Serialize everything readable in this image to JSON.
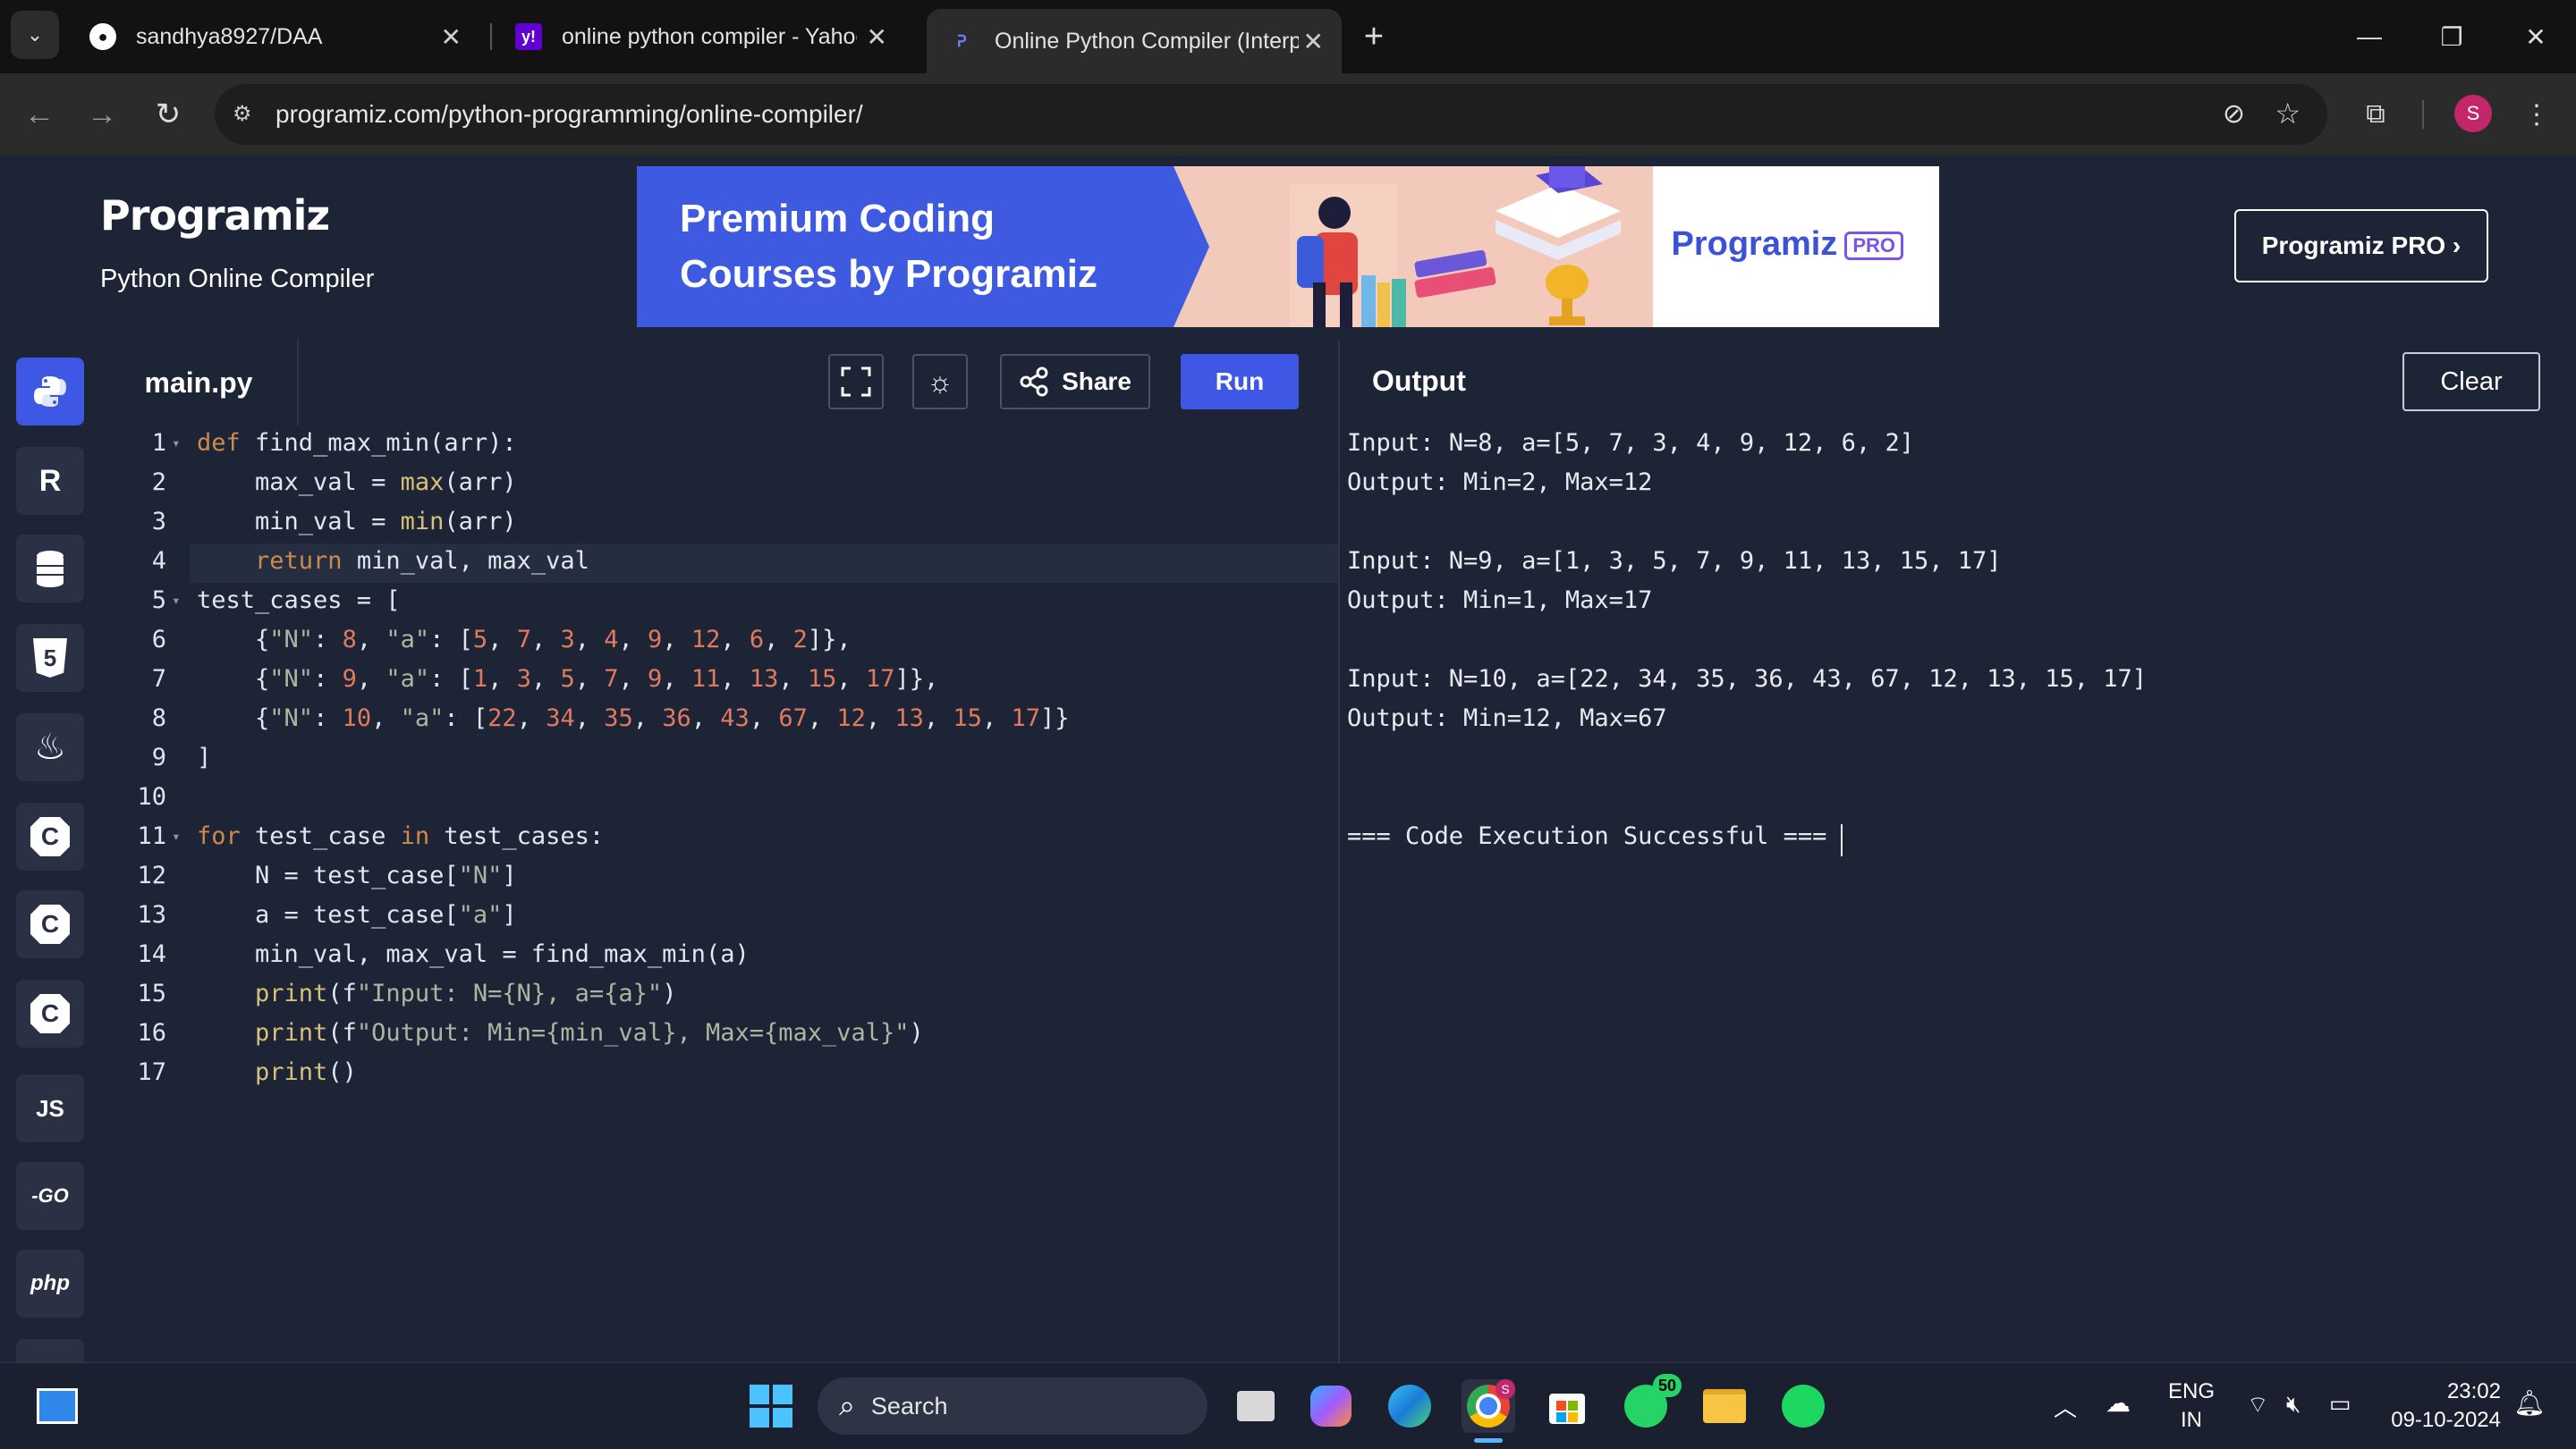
{
  "browser": {
    "tabs": [
      {
        "title": "sandhya8927/DAA",
        "icon": "github-icon"
      },
      {
        "title": "online python compiler - Yahoo",
        "icon": "yahoo-icon"
      },
      {
        "title": "Online Python Compiler (Interp",
        "icon": "programiz-icon",
        "active": true
      }
    ],
    "new_tab": "+",
    "url": "programiz.com/python-programming/online-compiler/",
    "profile_initial": "S"
  },
  "header": {
    "logo": "Programiz",
    "subtitle": "Python Online Compiler",
    "banner_headline_1": "Premium Coding",
    "banner_headline_2": "Courses by Programiz",
    "banner_logo": "Programiz",
    "banner_badge": "PRO",
    "pro_button": "Programiz PRO ›"
  },
  "languages": [
    {
      "name": "python-icon",
      "label": ""
    },
    {
      "name": "r-icon",
      "label": "R"
    },
    {
      "name": "sql-icon",
      "label": ""
    },
    {
      "name": "html5-icon",
      "label": "5"
    },
    {
      "name": "java-icon",
      "label": ""
    },
    {
      "name": "c-icon",
      "label": "C"
    },
    {
      "name": "csharp-icon",
      "label": "C"
    },
    {
      "name": "cpp-icon",
      "label": "C"
    },
    {
      "name": "js-icon",
      "label": "JS"
    },
    {
      "name": "go-icon",
      "label": "-GO"
    },
    {
      "name": "php-icon",
      "label": "php"
    }
  ],
  "editor": {
    "filename": "main.py",
    "share_label": "Share",
    "run_label": "Run",
    "line_numbers": [
      "1",
      "2",
      "3",
      "4",
      "5",
      "6",
      "7",
      "8",
      "9",
      "10",
      "11",
      "12",
      "13",
      "14",
      "15",
      "16",
      "17"
    ],
    "lines": [
      "def find_max_min(arr):",
      "    max_val = max(arr)",
      "    min_val = min(arr)",
      "    return min_val, max_val",
      "test_cases = [",
      "    {\"N\": 8, \"a\": [5, 7, 3, 4, 9, 12, 6, 2]},",
      "    {\"N\": 9, \"a\": [1, 3, 5, 7, 9, 11, 13, 15, 17]},",
      "    {\"N\": 10, \"a\": [22, 34, 35, 36, 43, 67, 12, 13, 15, 17]}",
      "]",
      "",
      "for test_case in test_cases:",
      "    N = test_case[\"N\"]",
      "    a = test_case[\"a\"]",
      "    min_val, max_val = find_max_min(a)",
      "    print(f\"Input: N={N}, a={a}\")",
      "    print(f\"Output: Min={min_val}, Max={max_val}\")",
      "    print()"
    ]
  },
  "output": {
    "title": "Output",
    "clear_label": "Clear",
    "lines": [
      "Input: N=8, a=[5, 7, 3, 4, 9, 12, 6, 2]",
      "Output: Min=2, Max=12",
      "",
      "Input: N=9, a=[1, 3, 5, 7, 9, 11, 13, 15, 17]",
      "Output: Min=1, Max=17",
      "",
      "Input: N=10, a=[22, 34, 35, 36, 43, 67, 12, 13, 15, 17]",
      "Output: Min=12, Max=67",
      "",
      "",
      "=== Code Execution Successful ==="
    ]
  },
  "taskbar": {
    "search_label": "Search",
    "whatsapp_badge": "50",
    "chrome_badge": "S",
    "lang_1": "ENG",
    "lang_2": "IN",
    "time": "23:02",
    "date": "09-10-2024"
  },
  "colors": {
    "accent": "#3e57e5",
    "background": "#1d2435",
    "keyword": "#cd8a4c",
    "number": "#e07a5f"
  }
}
